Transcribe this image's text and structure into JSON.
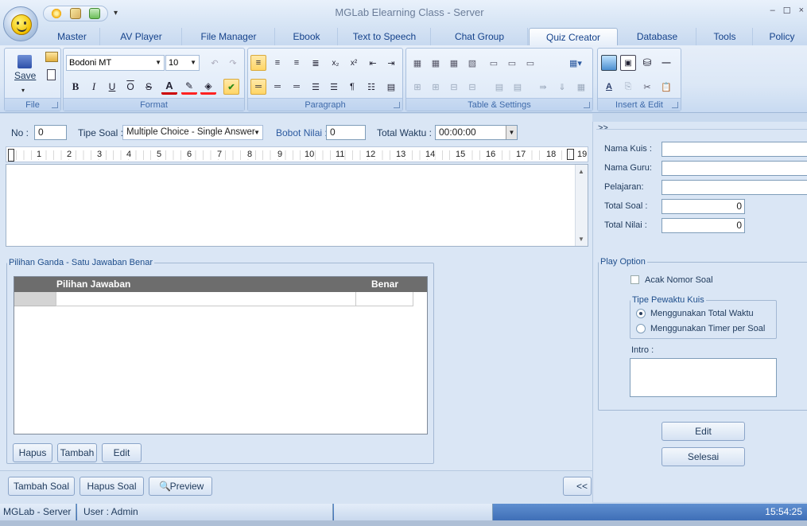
{
  "window": {
    "title": "MGLab  Elearning Class -   Server",
    "minimize": "–",
    "maximize": "☐",
    "close": "×"
  },
  "tabs": [
    {
      "label": "Master"
    },
    {
      "label": "AV Player"
    },
    {
      "label": "File Manager"
    },
    {
      "label": "Ebook"
    },
    {
      "label": "Text to Speech"
    },
    {
      "label": "Chat Group"
    },
    {
      "label": "Quiz Creator",
      "active": true
    },
    {
      "label": "Database"
    },
    {
      "label": "Tools"
    },
    {
      "label": "Policy"
    }
  ],
  "ribbon": {
    "file": {
      "label": "File",
      "save": "Save"
    },
    "format": {
      "label": "Format",
      "font": "Bodoni MT",
      "size": "10"
    },
    "paragraph": {
      "label": "Paragraph"
    },
    "table": {
      "label": "Table & Settings"
    },
    "insert": {
      "label": "Insert & Edit"
    },
    "colors": {
      "font_color": "#cc0000",
      "highlight": "#ff2222",
      "accent": "#ffd566"
    }
  },
  "question_bar": {
    "no_label": "No :",
    "no_value": "0",
    "type_label": "Tipe Soal :",
    "type_value": "Multiple Choice - Single Answer",
    "weight_label": "Bobot Nilai :",
    "weight_value": "0",
    "time_label": "Total Waktu :",
    "time_value": "00:00:00"
  },
  "ruler": {
    "marks": [
      "1",
      "2",
      "3",
      "4",
      "5",
      "6",
      "7",
      "8",
      "9",
      "10",
      "11",
      "12",
      "13",
      "14",
      "15",
      "16",
      "17",
      "18",
      "19"
    ]
  },
  "answers": {
    "legend": "Pilihan Ganda - Satu Jawaban Benar",
    "col_answer": "Pilihan Jawaban",
    "col_correct": "Benar",
    "delete": "Hapus",
    "add": "Tambah",
    "edit": "Edit"
  },
  "bottom": {
    "add_question": "Tambah Soal",
    "delete_question": "Hapus Soal",
    "preview": "Preview",
    "prev": "<< S"
  },
  "panel": {
    "toggle": ">>",
    "quiz_name_label": "Nama Kuis :",
    "quiz_name": "",
    "teacher_label": "Nama Guru:",
    "teacher": "",
    "subject_label": "Pelajaran:",
    "subject": "",
    "total_questions_label": "Total Soal :",
    "total_questions": "0",
    "total_score_label": "Total Nilai :",
    "total_score": "0",
    "play_option": "Play Option",
    "random_label": "Acak Nomor Soal",
    "timer_type": "Tipe Pewaktu Kuis",
    "timer_total": "Menggunakan Total Waktu",
    "timer_per_question": "Menggunakan Timer per Soal",
    "intro_label": "Intro :",
    "edit": "Edit",
    "finish": "Selesai"
  },
  "status": {
    "app": "MGLab - Server",
    "user": "User : Admin",
    "time": "15:54:25"
  }
}
